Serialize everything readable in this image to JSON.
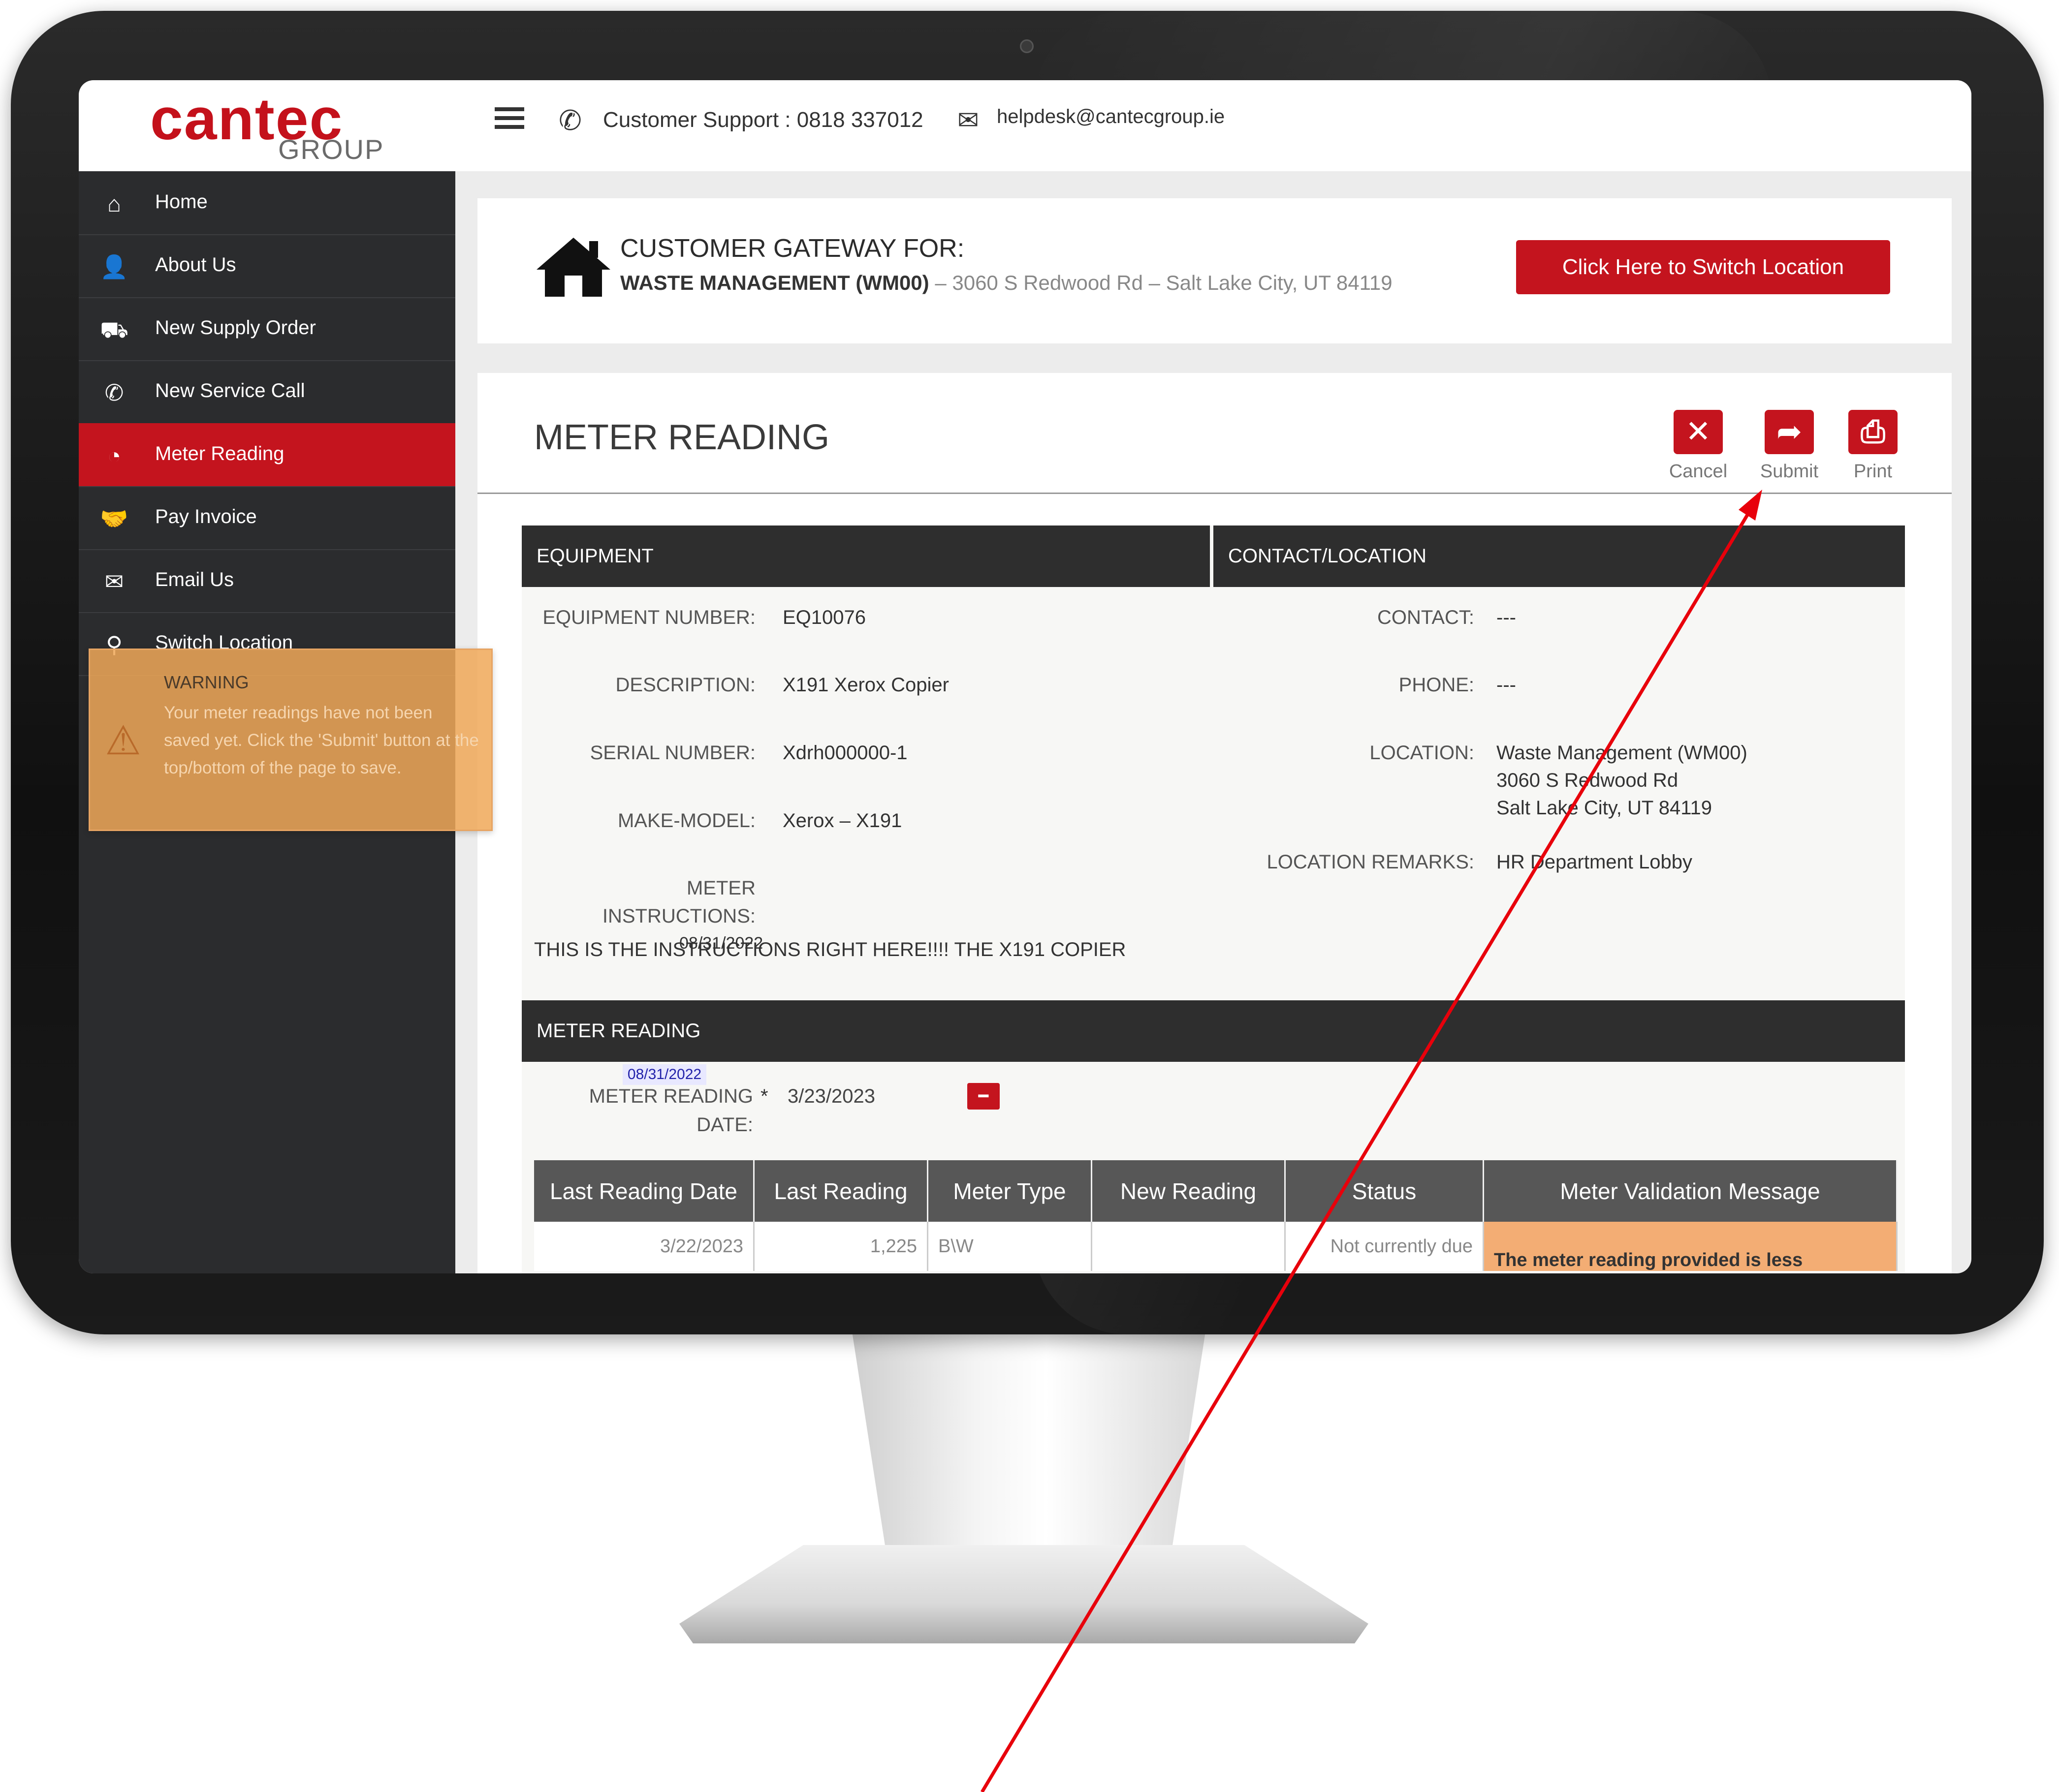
{
  "brand": {
    "name": "cantec",
    "sub": "GROUP"
  },
  "topbar": {
    "support_label": "Customer Support : 0818 337012",
    "email": "helpdesk@cantecgroup.ie"
  },
  "sidebar": {
    "items": [
      {
        "label": "Home",
        "icon": "home-icon"
      },
      {
        "label": "About Us",
        "icon": "user-icon"
      },
      {
        "label": "New Supply Order",
        "icon": "supply-icon"
      },
      {
        "label": "New Service Call",
        "icon": "service-icon"
      },
      {
        "label": "Meter Reading",
        "icon": "meter-icon"
      },
      {
        "label": "Pay Invoice",
        "icon": "handshake-icon"
      },
      {
        "label": "Email Us",
        "icon": "envelope-icon"
      },
      {
        "label": "Switch Location",
        "icon": "location-icon"
      }
    ]
  },
  "warning": {
    "title": "WARNING",
    "text": "Your meter readings have not been saved yet. Click the 'Submit' button at the top/bottom of the page to save."
  },
  "gateway": {
    "title": "CUSTOMER GATEWAY FOR:",
    "customer": "WASTE MANAGEMENT (WM00)",
    "address": " – 3060 S Redwood Rd – Salt Lake City, UT 84119",
    "switch_button": "Click Here to Switch Location"
  },
  "page": {
    "title": "METER READING",
    "actions": {
      "cancel": "Cancel",
      "submit": "Submit",
      "print": "Print"
    }
  },
  "equipment": {
    "header": "EQUIPMENT",
    "number_label": "EQUIPMENT NUMBER:",
    "number": "EQ10076",
    "description_label": "DESCRIPTION:",
    "description": "X191 Xerox Copier",
    "serial_label": "SERIAL NUMBER:",
    "serial": "Xdrh000000-1",
    "model_label": "MAKE-MODEL:",
    "model": "Xerox – X191",
    "instructions_label_1": "METER",
    "instructions_label_2": "INSTRUCTIONS:",
    "instructions": "THIS IS THE INSTRUCTIONS RIGHT HERE!!!! THE X191 COPIER",
    "overlay_date": "08/31/2022"
  },
  "contact": {
    "header": "CONTACT/LOCATION",
    "contact_label": "CONTACT:",
    "contact": "---",
    "phone_label": "PHONE:",
    "phone": "---",
    "location_label": "LOCATION:",
    "location_line1": "Waste Management (WM00)",
    "location_line2": "3060 S Redwood Rd",
    "location_line3": "Salt Lake City, UT 84119",
    "remarks_label": "LOCATION REMARKS:",
    "remarks": "HR Department Lobby"
  },
  "meter": {
    "header": "METER READING",
    "date_chip": "08/31/2022",
    "date_label_1": "METER READING",
    "date_label_2": "DATE:",
    "required": "*",
    "date_value": "3/23/2023",
    "columns": [
      "Last Reading Date",
      "Last Reading",
      "Meter Type",
      "New Reading",
      "Status",
      "Meter Validation Message"
    ],
    "rows": [
      {
        "last_date": "3/22/2023",
        "last_reading": "1,225",
        "meter_type": "B\\W",
        "new_reading": "",
        "status": "Not currently due",
        "message": "The meter reading provided is less"
      }
    ]
  },
  "colors": {
    "accent": "#c4141e",
    "sidebar": "#2b2c2e",
    "warning": "#f0a858",
    "annotation_arrow": "#e8000b"
  }
}
